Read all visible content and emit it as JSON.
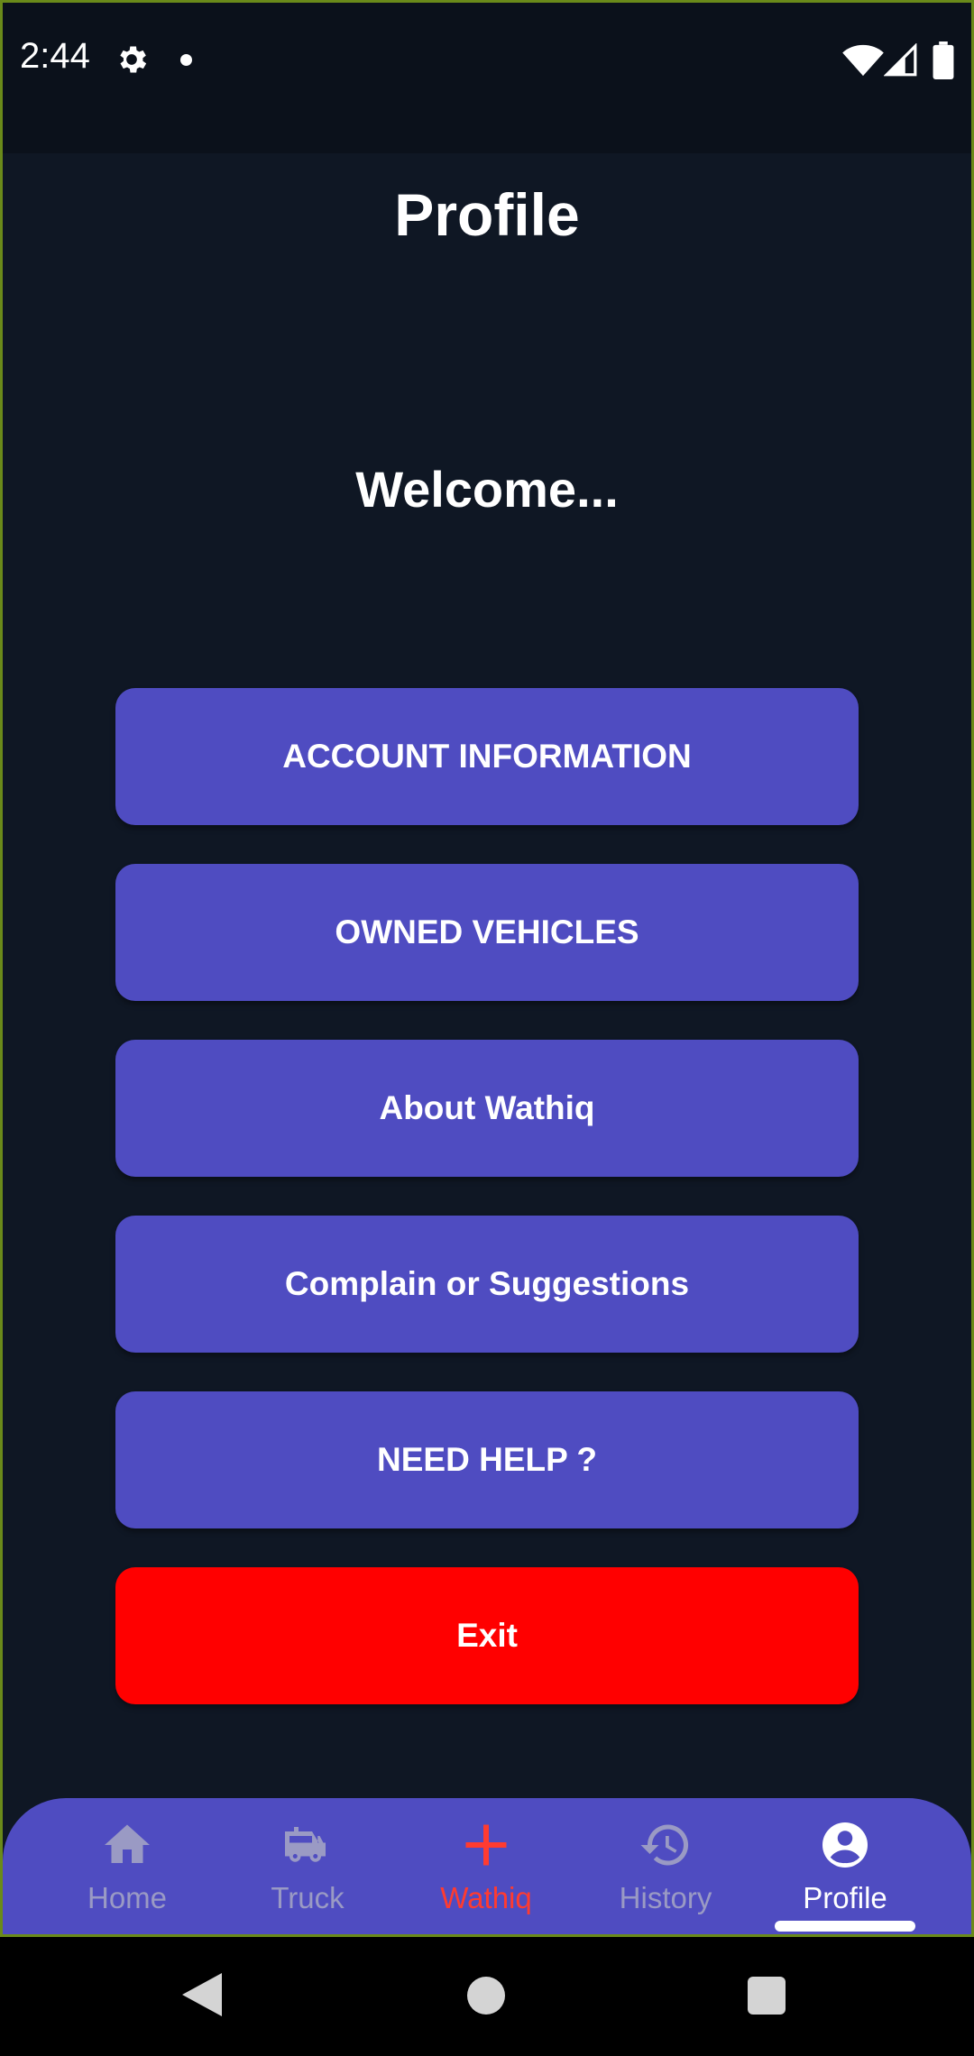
{
  "status_bar": {
    "time": "2:44",
    "icons": [
      "gear-icon",
      "notification-dot",
      "wifi-icon",
      "signal-icon",
      "battery-icon"
    ]
  },
  "header": {
    "title": "Profile"
  },
  "welcome": {
    "text": "Welcome..."
  },
  "menu": {
    "account_information": "ACCOUNT INFORMATION",
    "owned_vehicles": "OWNED VEHICLES",
    "about": "About Wathiq",
    "complain": "Complain or Suggestions",
    "need_help": "NEED HELP ?",
    "exit": "Exit"
  },
  "bottom_nav": {
    "items": [
      {
        "label": "Home",
        "icon": "home-icon"
      },
      {
        "label": "Truck",
        "icon": "truck-icon"
      },
      {
        "label": "Wathiq",
        "icon": "plus-icon"
      },
      {
        "label": "History",
        "icon": "history-icon"
      },
      {
        "label": "Profile",
        "icon": "account-circle-icon"
      }
    ],
    "active": "Profile"
  },
  "colors": {
    "background": "#0f1724",
    "button": "#4f4cc1",
    "exit_button": "#ff0000",
    "nav_inactive": "#9a9ac4",
    "wathiq_accent": "#ff3b30"
  }
}
